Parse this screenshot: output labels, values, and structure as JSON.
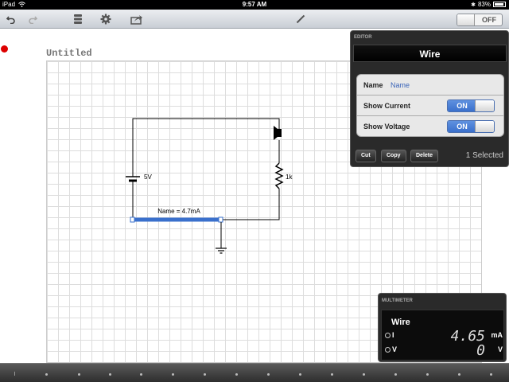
{
  "status_bar": {
    "carrier": "iPad",
    "time": "9:57 AM",
    "battery": "83%"
  },
  "toolbar": {
    "switch_label": "OFF"
  },
  "document": {
    "title": "Untitled"
  },
  "circuit": {
    "battery_label": "5V",
    "resistor_label": "1k",
    "wire_label": "Name = 4.7mA"
  },
  "editor": {
    "header": "EDITOR",
    "title": "Wire",
    "rows": [
      {
        "label": "Name",
        "value": "Name"
      },
      {
        "label": "Show Current",
        "toggle": "ON"
      },
      {
        "label": "Show Voltage",
        "toggle": "ON"
      }
    ],
    "buttons": [
      "Cut",
      "Copy",
      "Delete"
    ],
    "selection": "1 Selected"
  },
  "multimeter": {
    "header": "MULTIMETER",
    "name": "Wire",
    "lines": [
      {
        "quantity": "I",
        "reading": "4.65",
        "unit": "mA"
      },
      {
        "quantity": "V",
        "reading": "0",
        "unit": "V"
      }
    ]
  },
  "colors": {
    "accent": "#3a70cc",
    "record": "#dd0000"
  }
}
